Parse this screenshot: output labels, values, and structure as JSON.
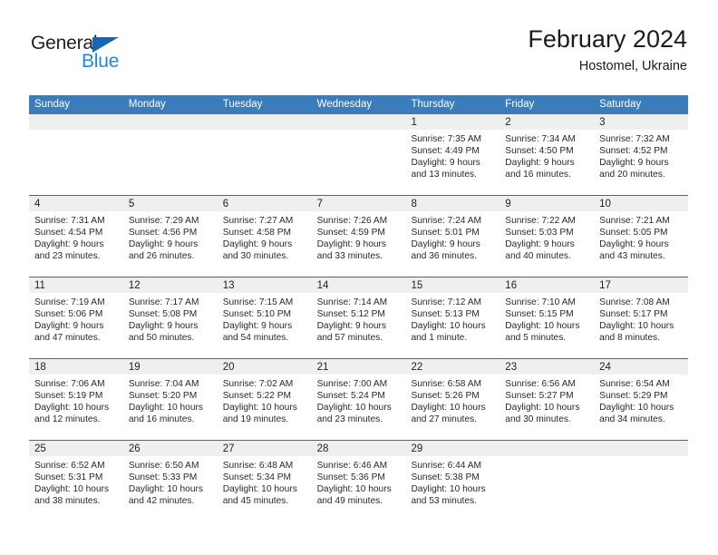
{
  "brand": {
    "name_part1": "General",
    "name_part2": "Blue",
    "triangle_color": "#1668b3",
    "blue_color": "#2288dd"
  },
  "header": {
    "title": "February 2024",
    "location": "Hostomel, Ukraine"
  },
  "theme": {
    "header_blue": "#3b7cbb",
    "row_rule_blue": "#2e6da9",
    "daynum_band": "#efefef"
  },
  "weekday_headers": [
    "Sunday",
    "Monday",
    "Tuesday",
    "Wednesday",
    "Thursday",
    "Friday",
    "Saturday"
  ],
  "weeks": [
    [
      {
        "day": "",
        "empty": true,
        "sunrise": "",
        "sunset": "",
        "daylight1": "",
        "daylight2": ""
      },
      {
        "day": "",
        "empty": true,
        "sunrise": "",
        "sunset": "",
        "daylight1": "",
        "daylight2": ""
      },
      {
        "day": "",
        "empty": true,
        "sunrise": "",
        "sunset": "",
        "daylight1": "",
        "daylight2": ""
      },
      {
        "day": "",
        "empty": true,
        "sunrise": "",
        "sunset": "",
        "daylight1": "",
        "daylight2": ""
      },
      {
        "day": "1",
        "empty": false,
        "sunrise": "Sunrise: 7:35 AM",
        "sunset": "Sunset: 4:49 PM",
        "daylight1": "Daylight: 9 hours",
        "daylight2": "and 13 minutes."
      },
      {
        "day": "2",
        "empty": false,
        "sunrise": "Sunrise: 7:34 AM",
        "sunset": "Sunset: 4:50 PM",
        "daylight1": "Daylight: 9 hours",
        "daylight2": "and 16 minutes."
      },
      {
        "day": "3",
        "empty": false,
        "sunrise": "Sunrise: 7:32 AM",
        "sunset": "Sunset: 4:52 PM",
        "daylight1": "Daylight: 9 hours",
        "daylight2": "and 20 minutes."
      }
    ],
    [
      {
        "day": "4",
        "empty": false,
        "sunrise": "Sunrise: 7:31 AM",
        "sunset": "Sunset: 4:54 PM",
        "daylight1": "Daylight: 9 hours",
        "daylight2": "and 23 minutes."
      },
      {
        "day": "5",
        "empty": false,
        "sunrise": "Sunrise: 7:29 AM",
        "sunset": "Sunset: 4:56 PM",
        "daylight1": "Daylight: 9 hours",
        "daylight2": "and 26 minutes."
      },
      {
        "day": "6",
        "empty": false,
        "sunrise": "Sunrise: 7:27 AM",
        "sunset": "Sunset: 4:58 PM",
        "daylight1": "Daylight: 9 hours",
        "daylight2": "and 30 minutes."
      },
      {
        "day": "7",
        "empty": false,
        "sunrise": "Sunrise: 7:26 AM",
        "sunset": "Sunset: 4:59 PM",
        "daylight1": "Daylight: 9 hours",
        "daylight2": "and 33 minutes."
      },
      {
        "day": "8",
        "empty": false,
        "sunrise": "Sunrise: 7:24 AM",
        "sunset": "Sunset: 5:01 PM",
        "daylight1": "Daylight: 9 hours",
        "daylight2": "and 36 minutes."
      },
      {
        "day": "9",
        "empty": false,
        "sunrise": "Sunrise: 7:22 AM",
        "sunset": "Sunset: 5:03 PM",
        "daylight1": "Daylight: 9 hours",
        "daylight2": "and 40 minutes."
      },
      {
        "day": "10",
        "empty": false,
        "sunrise": "Sunrise: 7:21 AM",
        "sunset": "Sunset: 5:05 PM",
        "daylight1": "Daylight: 9 hours",
        "daylight2": "and 43 minutes."
      }
    ],
    [
      {
        "day": "11",
        "empty": false,
        "sunrise": "Sunrise: 7:19 AM",
        "sunset": "Sunset: 5:06 PM",
        "daylight1": "Daylight: 9 hours",
        "daylight2": "and 47 minutes."
      },
      {
        "day": "12",
        "empty": false,
        "sunrise": "Sunrise: 7:17 AM",
        "sunset": "Sunset: 5:08 PM",
        "daylight1": "Daylight: 9 hours",
        "daylight2": "and 50 minutes."
      },
      {
        "day": "13",
        "empty": false,
        "sunrise": "Sunrise: 7:15 AM",
        "sunset": "Sunset: 5:10 PM",
        "daylight1": "Daylight: 9 hours",
        "daylight2": "and 54 minutes."
      },
      {
        "day": "14",
        "empty": false,
        "sunrise": "Sunrise: 7:14 AM",
        "sunset": "Sunset: 5:12 PM",
        "daylight1": "Daylight: 9 hours",
        "daylight2": "and 57 minutes."
      },
      {
        "day": "15",
        "empty": false,
        "sunrise": "Sunrise: 7:12 AM",
        "sunset": "Sunset: 5:13 PM",
        "daylight1": "Daylight: 10 hours",
        "daylight2": "and 1 minute."
      },
      {
        "day": "16",
        "empty": false,
        "sunrise": "Sunrise: 7:10 AM",
        "sunset": "Sunset: 5:15 PM",
        "daylight1": "Daylight: 10 hours",
        "daylight2": "and 5 minutes."
      },
      {
        "day": "17",
        "empty": false,
        "sunrise": "Sunrise: 7:08 AM",
        "sunset": "Sunset: 5:17 PM",
        "daylight1": "Daylight: 10 hours",
        "daylight2": "and 8 minutes."
      }
    ],
    [
      {
        "day": "18",
        "empty": false,
        "sunrise": "Sunrise: 7:06 AM",
        "sunset": "Sunset: 5:19 PM",
        "daylight1": "Daylight: 10 hours",
        "daylight2": "and 12 minutes."
      },
      {
        "day": "19",
        "empty": false,
        "sunrise": "Sunrise: 7:04 AM",
        "sunset": "Sunset: 5:20 PM",
        "daylight1": "Daylight: 10 hours",
        "daylight2": "and 16 minutes."
      },
      {
        "day": "20",
        "empty": false,
        "sunrise": "Sunrise: 7:02 AM",
        "sunset": "Sunset: 5:22 PM",
        "daylight1": "Daylight: 10 hours",
        "daylight2": "and 19 minutes."
      },
      {
        "day": "21",
        "empty": false,
        "sunrise": "Sunrise: 7:00 AM",
        "sunset": "Sunset: 5:24 PM",
        "daylight1": "Daylight: 10 hours",
        "daylight2": "and 23 minutes."
      },
      {
        "day": "22",
        "empty": false,
        "sunrise": "Sunrise: 6:58 AM",
        "sunset": "Sunset: 5:26 PM",
        "daylight1": "Daylight: 10 hours",
        "daylight2": "and 27 minutes."
      },
      {
        "day": "23",
        "empty": false,
        "sunrise": "Sunrise: 6:56 AM",
        "sunset": "Sunset: 5:27 PM",
        "daylight1": "Daylight: 10 hours",
        "daylight2": "and 30 minutes."
      },
      {
        "day": "24",
        "empty": false,
        "sunrise": "Sunrise: 6:54 AM",
        "sunset": "Sunset: 5:29 PM",
        "daylight1": "Daylight: 10 hours",
        "daylight2": "and 34 minutes."
      }
    ],
    [
      {
        "day": "25",
        "empty": false,
        "sunrise": "Sunrise: 6:52 AM",
        "sunset": "Sunset: 5:31 PM",
        "daylight1": "Daylight: 10 hours",
        "daylight2": "and 38 minutes."
      },
      {
        "day": "26",
        "empty": false,
        "sunrise": "Sunrise: 6:50 AM",
        "sunset": "Sunset: 5:33 PM",
        "daylight1": "Daylight: 10 hours",
        "daylight2": "and 42 minutes."
      },
      {
        "day": "27",
        "empty": false,
        "sunrise": "Sunrise: 6:48 AM",
        "sunset": "Sunset: 5:34 PM",
        "daylight1": "Daylight: 10 hours",
        "daylight2": "and 45 minutes."
      },
      {
        "day": "28",
        "empty": false,
        "sunrise": "Sunrise: 6:46 AM",
        "sunset": "Sunset: 5:36 PM",
        "daylight1": "Daylight: 10 hours",
        "daylight2": "and 49 minutes."
      },
      {
        "day": "29",
        "empty": false,
        "sunrise": "Sunrise: 6:44 AM",
        "sunset": "Sunset: 5:38 PM",
        "daylight1": "Daylight: 10 hours",
        "daylight2": "and 53 minutes."
      },
      {
        "day": "",
        "empty": true,
        "sunrise": "",
        "sunset": "",
        "daylight1": "",
        "daylight2": ""
      },
      {
        "day": "",
        "empty": true,
        "sunrise": "",
        "sunset": "",
        "daylight1": "",
        "daylight2": ""
      }
    ]
  ]
}
